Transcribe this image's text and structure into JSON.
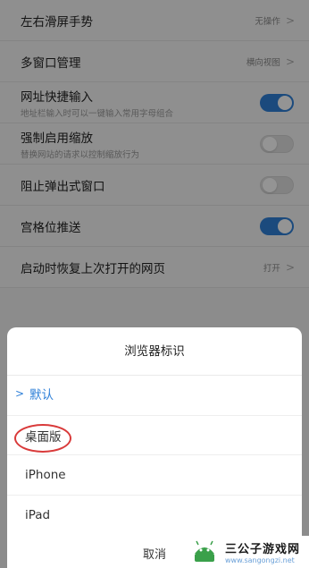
{
  "settings": {
    "items": [
      {
        "label": "左右滑屏手势",
        "value": "无操作"
      },
      {
        "label": "多窗口管理",
        "value": "横向视图"
      },
      {
        "label": "网址快捷输入",
        "sub": "地址栏输入时可以一键输入常用字母组合",
        "toggle": "on"
      },
      {
        "label": "强制启用缩放",
        "sub": "替换网站的请求以控制缩放行为",
        "toggle": "off"
      },
      {
        "label": "阻止弹出式窗口",
        "toggle": "off"
      },
      {
        "label": "宫格位推送",
        "toggle": "on"
      },
      {
        "label": "启动时恢复上次打开的网页",
        "value": "打开"
      }
    ]
  },
  "sheet": {
    "title": "浏览器标识",
    "options": [
      {
        "label": "默认",
        "selected": true
      },
      {
        "label": "桌面版",
        "selected": false
      },
      {
        "label": "iPhone",
        "selected": false
      },
      {
        "label": "iPad",
        "selected": false
      }
    ],
    "cancel_label": "取消"
  },
  "watermark": {
    "name": "三公子游戏网",
    "url": "www.sangongzi.net"
  },
  "colors": {
    "accent": "#2f80d8",
    "annotation": "#d93a3a"
  }
}
